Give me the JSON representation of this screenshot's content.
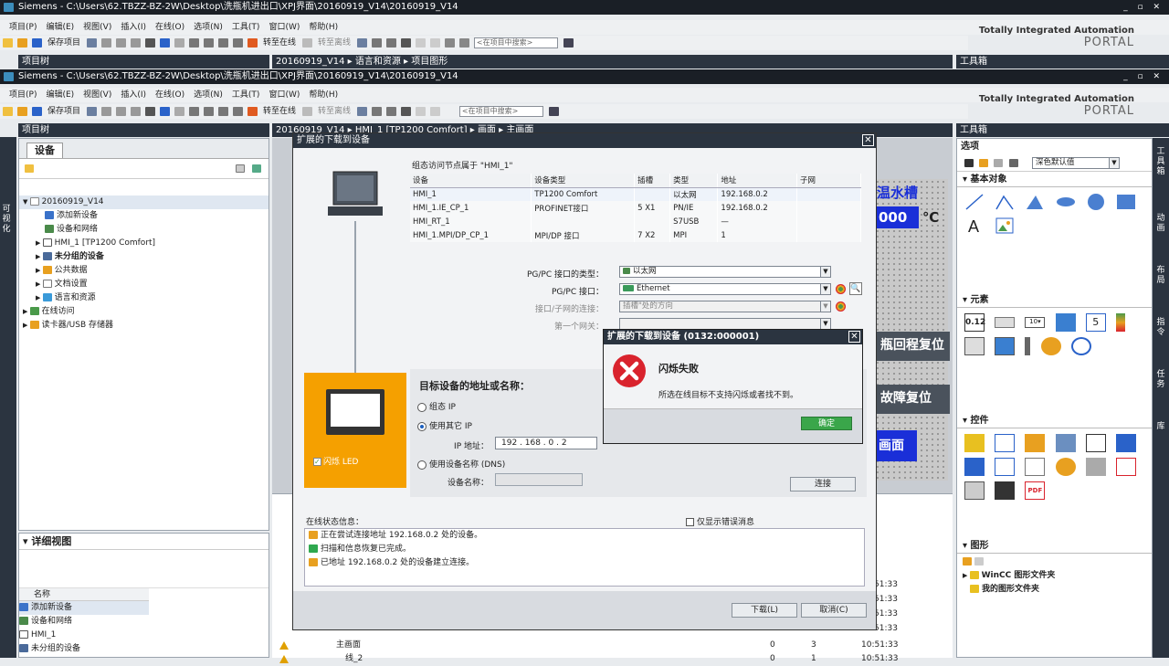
{
  "window": {
    "title1": "Siemens  -  C:\\Users\\62.TBZZ-BZ-2W\\Desktop\\洗瓶机进出口\\XPJ界面\\20160919_V14\\20160919_V14",
    "title2": "Siemens  -  C:\\Users\\62.TBZZ-BZ-2W\\Desktop\\洗瓶机进出口\\XPJ界面\\20160919_V14\\20160919_V14",
    "win_controls": "_ ▫ ✕"
  },
  "menu": [
    "项目(P)",
    "编辑(E)",
    "视图(V)",
    "插入(I)",
    "在线(O)",
    "选项(N)",
    "工具(T)",
    "窗口(W)",
    "帮助(H)"
  ],
  "toolbar": {
    "save": "保存项目",
    "go_online": "转至在线",
    "go_offline": "转至离线",
    "search_placeholder": "<在项目中搜索>"
  },
  "brand": {
    "line1": "Totally Integrated Automation",
    "line2": "PORTAL"
  },
  "project_tree": {
    "title": "项目树",
    "tab": "设备",
    "vertical_label": "可视化",
    "items": [
      {
        "label": "20160919_V14"
      },
      {
        "label": "添加新设备"
      },
      {
        "label": "设备和网络"
      },
      {
        "label": "HMI_1 [TP1200 Comfort]"
      },
      {
        "label": "未分组的设备"
      },
      {
        "label": "公共数据"
      },
      {
        "label": "文档设置"
      },
      {
        "label": "语言和资源"
      },
      {
        "label": "在线访问"
      },
      {
        "label": "读卡器/USB 存储器"
      }
    ]
  },
  "detail_view": {
    "title": "详细视图",
    "col": "名称",
    "items": [
      "添加新设备",
      "设备和网络",
      "HMI_1",
      "未分组的设备"
    ]
  },
  "breadcrumb1": "20160919_V14 ▸ 语言和资源 ▸ 项目图形",
  "breadcrumb2": "20160919_V14 ▸ HMI_1 [TP1200 Comfort] ▸ 画面 ▸ 主画面",
  "hmi": {
    "temp_label": "温水槽",
    "temp_value": "000",
    "temp_unit": "℃",
    "btn1": "瓶回程复位",
    "btn2": "故障复位",
    "btn3": "画面"
  },
  "download_dialog": {
    "title": "扩展的下载到设备",
    "nodes_caption": "组态访问节点属于 \"HMI_1\"",
    "columns": [
      "设备",
      "设备类型",
      "插槽",
      "类型",
      "地址",
      "子网"
    ],
    "rows": [
      [
        "HMI_1",
        "TP1200 Comfort",
        "",
        "以太网",
        "192.168.0.2",
        ""
      ],
      [
        "HMI_1.IE_CP_1",
        "PROFINET接口",
        "5 X1",
        "PN/IE",
        "192.168.0.2",
        ""
      ],
      [
        "HMI_RT_1",
        "",
        "",
        "S7USB",
        "—",
        ""
      ],
      [
        "HMI_1.MPI/DP_CP_1",
        "MPI/DP 接口",
        "7 X2",
        "MPI",
        "1",
        ""
      ]
    ],
    "pgpc_type_label": "PG/PC 接口的类型：",
    "pgpc_type_value": "以太网",
    "pgpc_label": "PG/PC 接口：",
    "pgpc_value": "Ethernet",
    "subnet_conn_label": "接口/子网的连接：",
    "subnet_conn_value": "插槽\"处的方向",
    "gateway_label": "第一个网关：",
    "flash_led": "闪烁 LED",
    "target_title": "目标设备的地址或名称：",
    "opt_configured": "组态 IP",
    "opt_other": "使用其它 IP",
    "ip_label": "IP 地址：",
    "ip_value": "192 . 168 . 0    . 2",
    "opt_dns": "使用设备名称 (DNS)",
    "devname_label": "设备名称：",
    "connect_btn": "连接",
    "status_title": "在线状态信息：",
    "errors_only": "仅显示错误消息",
    "status_lines": [
      "正在尝试连接地址 192.168.0.2 处的设备。",
      "扫描和信息恢复已完成。",
      "已地址 192.168.0.2 处的设备建立连接。"
    ],
    "download_btn": "下载(L)",
    "cancel_btn": "取消(C)"
  },
  "error_dialog": {
    "title": "扩展的下载到设备 (0132:000001)",
    "heading": "闪烁失败",
    "message": "所选在线目标不支持闪烁或者找不到。",
    "ok": "确定"
  },
  "toolbox": {
    "title": "工具箱",
    "options": "选项",
    "style": "深色默认值",
    "basic": "基本对象",
    "elements": "元素",
    "controls": "控件",
    "graphics": "图形",
    "wincc_folder": "WinCC 图形文件夹",
    "my_folder": "我的图形文件夹",
    "side_tabs": [
      "工具箱",
      "动画",
      "布局",
      "指令",
      "任务",
      "库"
    ]
  },
  "log": {
    "rows": [
      {
        "name": "主画面",
        "n1": "0",
        "n2": "3",
        "t": "10:51:33"
      },
      {
        "name": "线_2",
        "n1": "0",
        "n2": "1",
        "t": "10:51:33"
      }
    ],
    "times": [
      "51:33",
      "51:33",
      "51:33",
      "51:33"
    ]
  },
  "colors": {
    "dark": "#2b3440",
    "orange": "#f5a000",
    "error_red": "#d9232d",
    "blue": "#1a2fd8"
  }
}
